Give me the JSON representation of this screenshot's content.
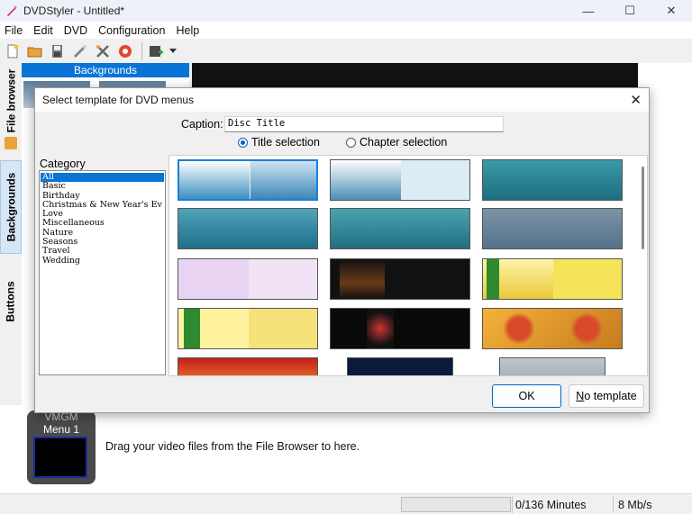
{
  "window": {
    "title": "DVDStyler - Untitled*",
    "buttons": {
      "minimize": "—",
      "maximize": "☐",
      "close": "✕"
    }
  },
  "menu": [
    "File",
    "Edit",
    "DVD",
    "Configuration",
    "Help"
  ],
  "toolbar": {
    "icons": [
      "new-file-icon",
      "open-folder-icon",
      "save-icon",
      "magic-wand-icon",
      "settings-tools-icon",
      "burn-disc-icon",
      "add-file-icon",
      "dropdown-arrow-icon"
    ]
  },
  "side_tabs": [
    "File browser",
    "Backgrounds",
    "Buttons"
  ],
  "backgrounds_panel": {
    "header": "Backgrounds"
  },
  "titleset": {
    "vmgm_label": "VMGM",
    "menu_label": "Menu 1",
    "drop_hint": "Drag your video files from the File Browser to here."
  },
  "statusbar": {
    "minutes": "0/136 Minutes",
    "bitrate": "8 Mb/s"
  },
  "dialog": {
    "title": "Select template for DVD menus",
    "close": "✕",
    "caption_label": "Caption:",
    "caption_value": "Disc Title",
    "radio_title": "Title selection",
    "radio_chapter": "Chapter selection",
    "selected_radio": "title",
    "category_label": "Category",
    "categories": [
      "All",
      "Basic",
      "Birthday",
      "Christmas & New Year's Ev",
      "Love",
      "Miscellaneous",
      "Nature",
      "Seasons",
      "Travel",
      "Wedding"
    ],
    "selected_category": "All",
    "ok_label": "OK",
    "no_template_first": "N",
    "no_template_rest": "o template",
    "template_count_visible": 15,
    "colors": {
      "accent": "#0a74d6",
      "ok_border": "#0067c0"
    }
  }
}
